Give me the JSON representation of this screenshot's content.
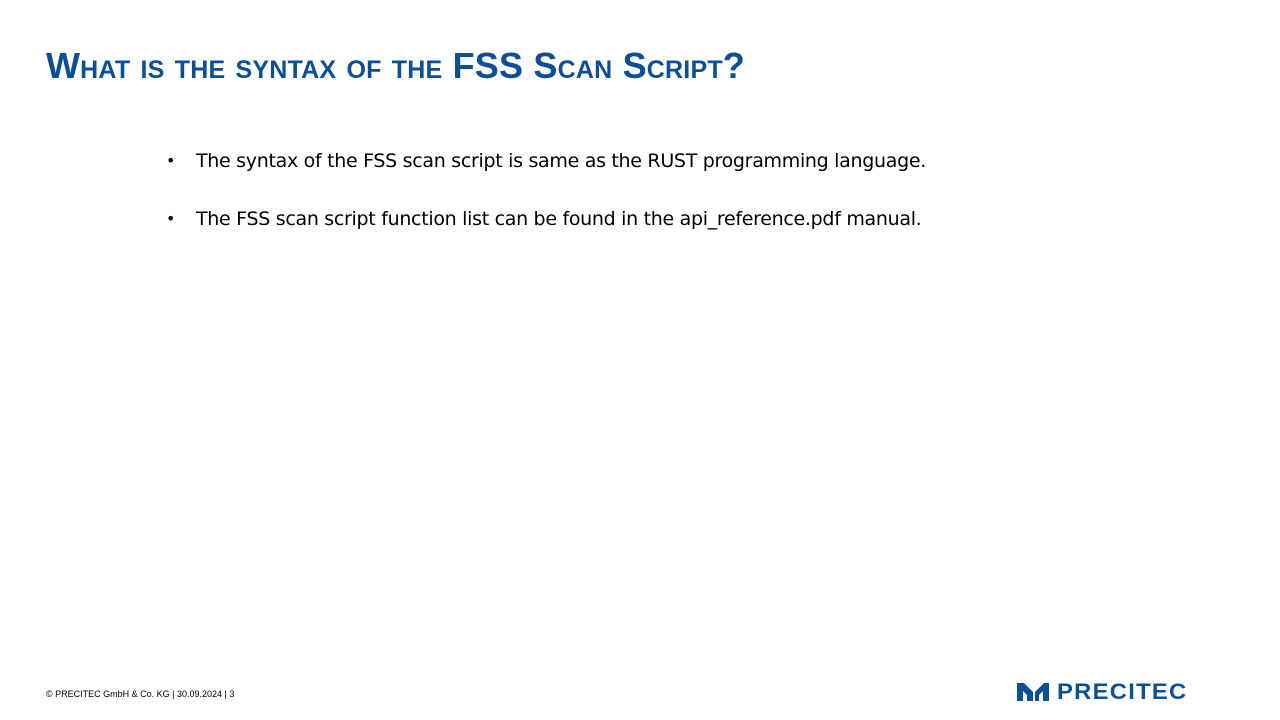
{
  "slide": {
    "title": "What is the syntax of the FSS Scan Script?",
    "bullets": [
      "The syntax of the FSS scan script is same as the RUST programming language.",
      "The FSS scan script function list can be found in the api_reference.pdf manual."
    ],
    "footer": "© PRECITEC GmbH & Co. KG | 30.09.2024 | 3",
    "logo_text": "PRECITEC",
    "bullet_symbol": "•"
  },
  "colors": {
    "title": "#0b4f96",
    "brand": "#0b4f96",
    "text": "#000000",
    "background": "#ffffff"
  },
  "icons": {
    "logo_mark": "precitec-logo-mark-icon"
  }
}
